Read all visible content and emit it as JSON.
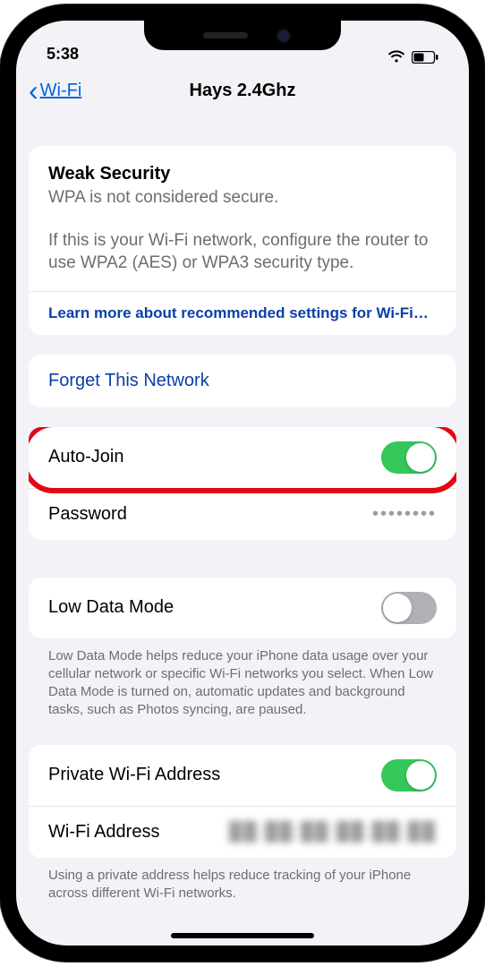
{
  "status": {
    "time": "5:38"
  },
  "nav": {
    "back": "Wi-Fi",
    "title": "Hays 2.4Ghz"
  },
  "security": {
    "heading": "Weak Security",
    "subtitle": "WPA is not considered secure.",
    "body": "If this is your Wi-Fi network, configure the router to use WPA2 (AES) or WPA3 security type.",
    "learn_more": "Learn more about recommended settings for Wi-Fi…"
  },
  "forget": {
    "label": "Forget This Network"
  },
  "settings": {
    "auto_join": {
      "label": "Auto-Join",
      "on": true
    },
    "password": {
      "label": "Password",
      "value": "••••••••"
    },
    "low_data": {
      "label": "Low Data Mode",
      "on": false,
      "footer": "Low Data Mode helps reduce your iPhone data usage over your cellular network or specific Wi-Fi networks you select. When Low Data Mode is turned on, automatic updates and background tasks, such as Photos syncing, are paused."
    },
    "private_addr": {
      "label": "Private Wi-Fi Address",
      "on": true
    },
    "wifi_addr": {
      "label": "Wi-Fi Address",
      "value": "██:██:██:██:██:██"
    },
    "footer2": "Using a private address helps reduce tracking of your iPhone across different Wi-Fi networks."
  }
}
